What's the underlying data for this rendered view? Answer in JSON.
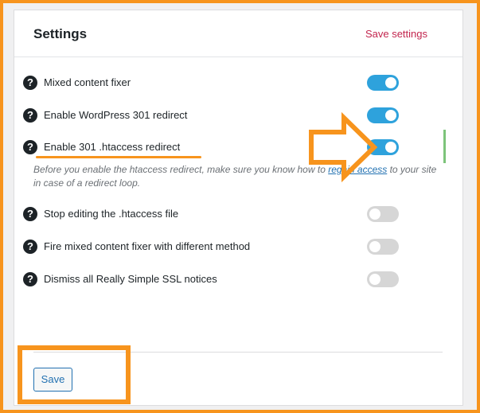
{
  "panel": {
    "title": "Settings",
    "save_settings_link": "Save settings"
  },
  "settings": [
    {
      "label": "Mixed content fixer",
      "enabled": true
    },
    {
      "label": "Enable WordPress 301 redirect",
      "enabled": true
    },
    {
      "label": "Enable 301 .htaccess redirect",
      "enabled": true
    },
    {
      "label": "Stop editing the .htaccess file",
      "enabled": false
    },
    {
      "label": "Fire mixed content fixer with different method",
      "enabled": false
    },
    {
      "label": "Dismiss all Really Simple SSL notices",
      "enabled": false
    }
  ],
  "htaccess_note": {
    "text_before": "Before you enable the htaccess redirect, make sure you know how to ",
    "link_text": "regain access",
    "text_after": " to your site in case of a redirect loop."
  },
  "help_icon_glyph": "?",
  "footer": {
    "save_button": "Save"
  },
  "colors": {
    "accent_orange": "#f7941d",
    "toggle_on": "#2ea2dc",
    "toggle_off": "#d6d6d6",
    "link_red": "#c3254e",
    "button_blue": "#2271b1"
  },
  "icons": {
    "help": "question-circle-icon",
    "annotation": "arrow-right-icon"
  }
}
